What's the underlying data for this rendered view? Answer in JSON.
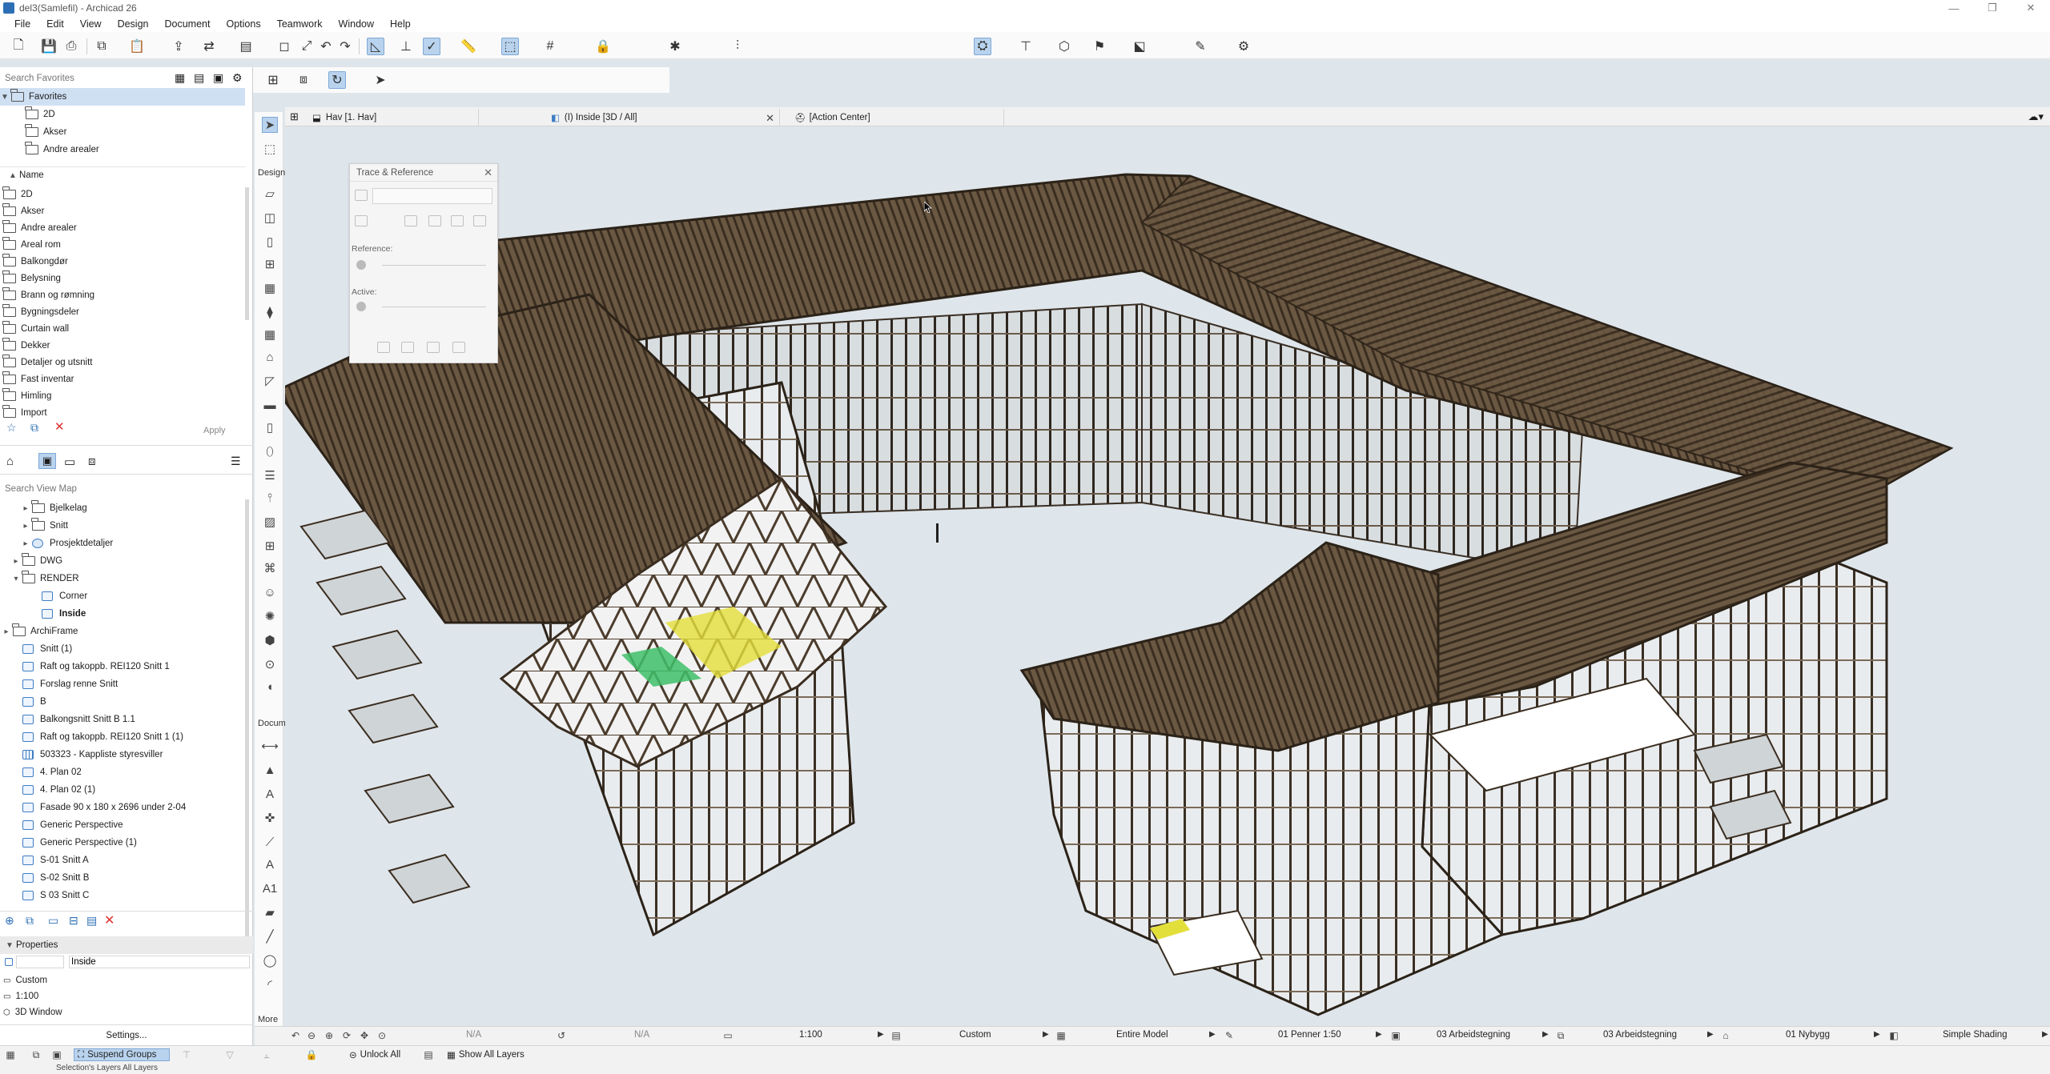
{
  "window": {
    "title": "del3(Samlefil) - Archicad 26",
    "minimize": "—",
    "restore": "❐",
    "close": "✕"
  },
  "menu": [
    "File",
    "Edit",
    "View",
    "Design",
    "Document",
    "Options",
    "Teamwork",
    "Window",
    "Help"
  ],
  "navigator": {
    "favorites_search_placeholder": "Search Favorites",
    "favorites_title": "Favorites",
    "favorites_items": [
      "2D",
      "Akser",
      "Andre arealer"
    ],
    "name_header": "Name",
    "folders": [
      "2D",
      "Akser",
      "Andre arealer",
      "Areal rom",
      "Balkongdør",
      "Belysning",
      "Brann og rømning",
      "Bygningsdeler",
      "Curtain wall",
      "Dekker",
      "Detaljer og utsnitt",
      "Fast inventar",
      "Himling",
      "Import"
    ],
    "apply_label": "Apply",
    "viewmap_search_placeholder": "Search View Map",
    "viewmap_items": [
      {
        "label": "Bjelkelag",
        "icon": "folder"
      },
      {
        "label": "Snitt",
        "icon": "folder"
      },
      {
        "label": "Prosjektdetaljer",
        "icon": "globe"
      },
      {
        "label": "DWG",
        "icon": "folder"
      },
      {
        "label": "RENDER",
        "icon": "folder"
      },
      {
        "label": "Corner",
        "icon": "view"
      },
      {
        "label": "Inside",
        "icon": "view"
      },
      {
        "label": "ArchiFrame",
        "icon": "folder"
      },
      {
        "label": "Snitt (1)",
        "icon": "view"
      },
      {
        "label": "Raft og takoppb. REI120 Snitt 1",
        "icon": "view"
      },
      {
        "label": "Forslag renne Snitt",
        "icon": "view"
      },
      {
        "label": "B",
        "icon": "view"
      },
      {
        "label": "Balkongsnitt Snitt B 1.1",
        "icon": "view"
      },
      {
        "label": "Raft og takoppb. REI120 Snitt 1 (1)",
        "icon": "view"
      },
      {
        "label": "503323 - Kappliste styresviller",
        "icon": "sched"
      },
      {
        "label": "4. Plan 02",
        "icon": "view"
      },
      {
        "label": "4. Plan 02 (1)",
        "icon": "view"
      },
      {
        "label": "Fasade 90 x 180 x 2696 under 2-04",
        "icon": "view"
      },
      {
        "label": "Generic Perspective",
        "icon": "view"
      },
      {
        "label": "Generic Perspective (1)",
        "icon": "view"
      },
      {
        "label": "S-01 Snitt A",
        "icon": "view"
      },
      {
        "label": "S-02 Snitt B",
        "icon": "view"
      },
      {
        "label": "S 03 Snitt C",
        "icon": "view"
      }
    ],
    "properties_title": "Properties",
    "properties_name": "Inside",
    "properties_rows": [
      "Custom",
      "1:100",
      "3D Window"
    ],
    "settings_label": "Settings..."
  },
  "toolbox": {
    "design_label": "Design",
    "document_label": "Docum",
    "more_label": "More"
  },
  "tabs": [
    {
      "label": "Hav [1. Hav]"
    },
    {
      "label": "(I) Inside [3D / All]",
      "close": "✕"
    },
    {
      "label": "[Action Center]"
    }
  ],
  "trace_palette": {
    "title": "Trace & Reference",
    "reference_label": "Reference:",
    "active_label": "Active:"
  },
  "statusbar": {
    "na1": "N/A",
    "na2": "N/A",
    "scale": "1:100",
    "structure": "Custom",
    "model": "Entire Model",
    "pen": "01 Penner 1:50",
    "mvo": "03 Arbeidstegning",
    "override": "03 Arbeidstegning",
    "renovation": "01 Nybygg",
    "shading": "Simple Shading"
  },
  "bottombar": {
    "suspend": "Suspend Groups",
    "unlock": "Unlock All",
    "show_layers": "Show All Layers",
    "selection_layers": "Selection's Layers All Layers"
  },
  "colors": {
    "accent": "#b9d3ee",
    "frame": "#4b3c2c",
    "roof": "#5b4936",
    "sky": "#dfe6eb"
  }
}
